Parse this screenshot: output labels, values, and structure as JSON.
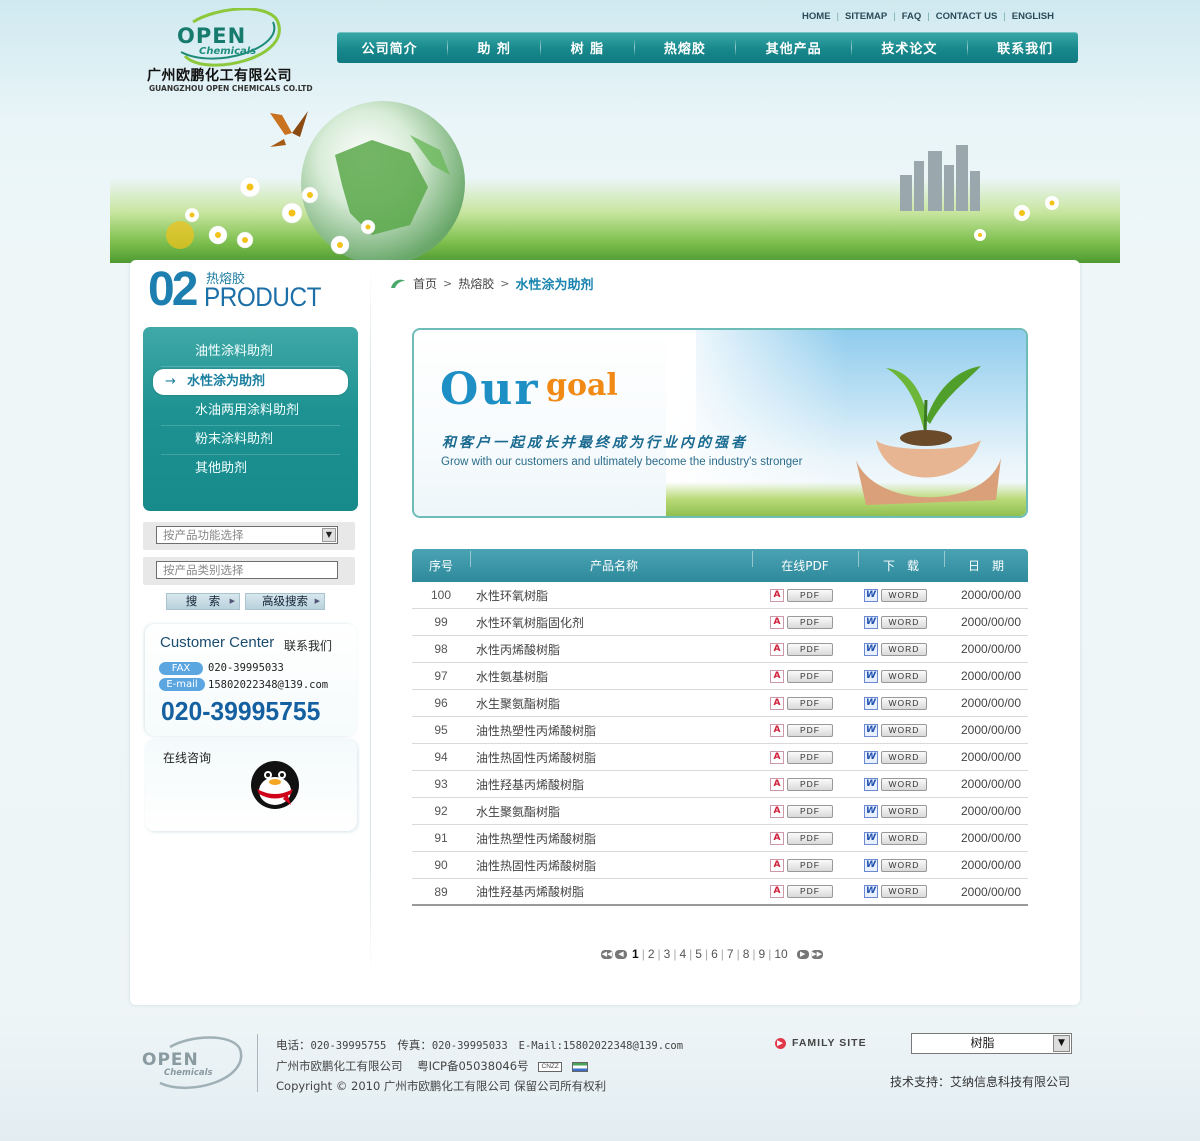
{
  "brand": {
    "logo_open": "OPEN",
    "logo_chemicals": "Chemicals",
    "company_cn": "广州欧鹏化工有限公司",
    "company_en": "GUANGZHOU OPEN CHEMICALS CO.LTD",
    "brand_color": "#167a6d"
  },
  "utility_nav": [
    "HOME",
    "SITEMAP",
    "FAQ",
    "CONTACT US",
    "ENGLISH"
  ],
  "main_nav": [
    "公司简介",
    "助 剂",
    "树 脂",
    "热熔胶",
    "其他产品",
    "技术论文",
    "联系我们"
  ],
  "section": {
    "number": "02",
    "subtitle": "热熔胶",
    "title": "PRODUCT"
  },
  "categories": [
    {
      "label": "油性涂料助剂",
      "active": false
    },
    {
      "label": "水性涂为助剂",
      "active": true
    },
    {
      "label": "水油两用涂料助剂",
      "active": false
    },
    {
      "label": "粉末涂料助剂",
      "active": false
    },
    {
      "label": "其他助剂",
      "active": false
    }
  ],
  "search": {
    "function_placeholder": "按产品功能选择",
    "type_placeholder": "按产品类别选择",
    "search_label": "搜　索",
    "advanced_label": "高级搜索"
  },
  "customer": {
    "title": "Customer Center",
    "title_cn": "联系我们",
    "fax_label": "FAX",
    "fax": "020-39995033",
    "email_label": "E-mail",
    "email": "15802022348@139.com",
    "phone": "020-39995755"
  },
  "qq": {
    "title": "在线咨询"
  },
  "breadcrumb": {
    "home": "首页",
    "parent": "热熔胶",
    "current": "水性涂为助剂"
  },
  "goal": {
    "our": "Our",
    "goal": "goal",
    "slogan_cn": "和客户一起成长并最终成为行业内的强者",
    "slogan_en": "Grow with our customers and ultimately become the industry's stronger"
  },
  "table": {
    "headers": [
      "序号",
      "产品名称",
      "在线PDF",
      "下　载",
      "日　期"
    ],
    "pdf_label": "PDF",
    "word_label": "WORD",
    "rows": [
      {
        "no": "100",
        "name": "水性环氧树脂",
        "date": "2000/00/00"
      },
      {
        "no": "99",
        "name": "水性环氧树脂固化剂",
        "date": "2000/00/00"
      },
      {
        "no": "98",
        "name": "水性丙烯酸树脂",
        "date": "2000/00/00"
      },
      {
        "no": "97",
        "name": "水性氨基树脂",
        "date": "2000/00/00"
      },
      {
        "no": "96",
        "name": "水生聚氨酯树脂",
        "date": "2000/00/00"
      },
      {
        "no": "95",
        "name": "油性热塑性丙烯酸树脂",
        "date": "2000/00/00"
      },
      {
        "no": "94",
        "name": "油性热固性丙烯酸树脂",
        "date": "2000/00/00"
      },
      {
        "no": "93",
        "name": "油性羟基丙烯酸树脂",
        "date": "2000/00/00"
      },
      {
        "no": "92",
        "name": "水生聚氨酯树脂",
        "date": "2000/00/00"
      },
      {
        "no": "91",
        "name": "油性热塑性丙烯酸树脂",
        "date": "2000/00/00"
      },
      {
        "no": "90",
        "name": "油性热固性丙烯酸树脂",
        "date": "2000/00/00"
      },
      {
        "no": "89",
        "name": "油性羟基丙烯酸树脂",
        "date": "2000/00/00"
      }
    ]
  },
  "pagination": {
    "current": "1",
    "pages": [
      "1",
      "2",
      "3",
      "4",
      "5",
      "6",
      "7",
      "8",
      "9",
      "10"
    ]
  },
  "footer": {
    "logo_open": "OPEN",
    "logo_chemicals": "Chemicals",
    "line1_label_tel": "电话：",
    "tel": "020-39995755",
    "line1_label_fax": "传真：",
    "fax": "020-39995033",
    "line1_label_email": "E-Mail:",
    "email": "15802022348@139.com",
    "company": "广州市欧鹏化工有限公司",
    "icp": "粤ICP备05038046号",
    "badge": "CNZZ",
    "copyright": "Copyright © 2010 广州市欧鹏化工有限公司 保留公司所有权利",
    "family_site": "FAMILY SITE",
    "family_selected": "树脂",
    "support": "技术支持：艾纳信息科技有限公司"
  }
}
